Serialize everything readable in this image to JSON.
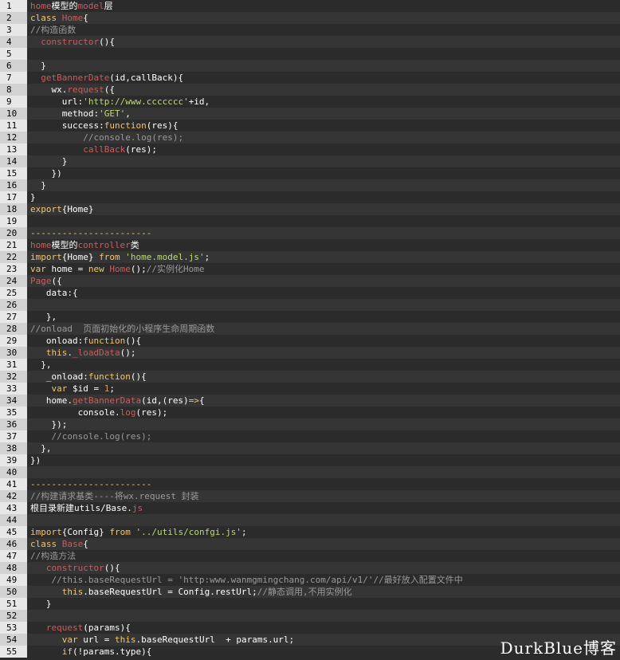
{
  "watermark": "DurkBlue博客",
  "colors": {
    "background": "#2b2b2b",
    "gutter": "#e7e7e7",
    "keyword": "#f0c674",
    "function": "#c65e5e",
    "string": "#bfd97a",
    "comment": "#9a9a9a",
    "number": "#d19a66"
  },
  "lines": [
    {
      "n": "1",
      "t": [
        [
          "fn",
          "home"
        ],
        [
          "pl",
          "模型的"
        ],
        [
          "fn",
          "model"
        ],
        [
          "pl",
          "层"
        ]
      ]
    },
    {
      "n": "2",
      "t": [
        [
          "kw",
          "class "
        ],
        [
          "fn",
          "Home"
        ],
        [
          "pl",
          "{"
        ]
      ]
    },
    {
      "n": "3",
      "t": [
        [
          "cm",
          "//构造函数"
        ]
      ]
    },
    {
      "n": "4",
      "t": [
        [
          "pl",
          "  "
        ],
        [
          "fn",
          "constructor"
        ],
        [
          "pl",
          "(){"
        ]
      ]
    },
    {
      "n": "5",
      "t": []
    },
    {
      "n": "6",
      "t": [
        [
          "pl",
          "  }"
        ]
      ]
    },
    {
      "n": "7",
      "t": [
        [
          "pl",
          "  "
        ],
        [
          "fn",
          "getBannerDate"
        ],
        [
          "pl",
          "(id,callBack){"
        ]
      ]
    },
    {
      "n": "8",
      "t": [
        [
          "pl",
          "    wx."
        ],
        [
          "fn",
          "request"
        ],
        [
          "pl",
          "({"
        ]
      ]
    },
    {
      "n": "9",
      "t": [
        [
          "pl",
          "      url:"
        ],
        [
          "str",
          "'http://www.ccccccc'"
        ],
        [
          "pl",
          "+id,"
        ]
      ]
    },
    {
      "n": "10",
      "t": [
        [
          "pl",
          "      method:"
        ],
        [
          "str",
          "'GET'"
        ],
        [
          "pl",
          ","
        ]
      ]
    },
    {
      "n": "11",
      "t": [
        [
          "pl",
          "      success:"
        ],
        [
          "kw",
          "function"
        ],
        [
          "pl",
          "(res){"
        ]
      ]
    },
    {
      "n": "12",
      "t": [
        [
          "pl",
          "          "
        ],
        [
          "cm",
          "//console.log(res);"
        ]
      ]
    },
    {
      "n": "13",
      "t": [
        [
          "pl",
          "          "
        ],
        [
          "fn",
          "callBack"
        ],
        [
          "pl",
          "(res);"
        ]
      ]
    },
    {
      "n": "14",
      "t": [
        [
          "pl",
          "      }"
        ]
      ]
    },
    {
      "n": "15",
      "t": [
        [
          "pl",
          "    })"
        ]
      ]
    },
    {
      "n": "16",
      "t": [
        [
          "pl",
          "  }"
        ]
      ]
    },
    {
      "n": "17",
      "t": [
        [
          "pl",
          "}"
        ]
      ]
    },
    {
      "n": "18",
      "t": [
        [
          "kw",
          "export"
        ],
        [
          "pl",
          "{Home}"
        ]
      ]
    },
    {
      "n": "19",
      "t": []
    },
    {
      "n": "20",
      "t": [
        [
          "kw",
          "-----------------------"
        ]
      ]
    },
    {
      "n": "21",
      "t": [
        [
          "fn",
          "home"
        ],
        [
          "pl",
          "模型的"
        ],
        [
          "fn",
          "controller"
        ],
        [
          "pl",
          "类"
        ]
      ]
    },
    {
      "n": "22",
      "t": [
        [
          "kw",
          "import"
        ],
        [
          "pl",
          "{Home} "
        ],
        [
          "kw",
          "from "
        ],
        [
          "str",
          "'home.model.js'"
        ],
        [
          "pl",
          ";"
        ]
      ]
    },
    {
      "n": "23",
      "t": [
        [
          "kw",
          "var "
        ],
        [
          "pl",
          "home = "
        ],
        [
          "kw",
          "new "
        ],
        [
          "fn",
          "Home"
        ],
        [
          "pl",
          "();"
        ],
        [
          "cm",
          "//实例化Home"
        ]
      ]
    },
    {
      "n": "24",
      "t": [
        [
          "fn",
          "Page"
        ],
        [
          "pl",
          "({"
        ]
      ]
    },
    {
      "n": "25",
      "t": [
        [
          "pl",
          "   data:{"
        ]
      ]
    },
    {
      "n": "26",
      "t": []
    },
    {
      "n": "27",
      "t": [
        [
          "pl",
          "   },"
        ]
      ]
    },
    {
      "n": "28",
      "t": [
        [
          "cm",
          "//onload  页面初始化的小程序生命周期函数"
        ]
      ]
    },
    {
      "n": "29",
      "t": [
        [
          "pl",
          "   onload:"
        ],
        [
          "kw",
          "function"
        ],
        [
          "pl",
          "(){"
        ]
      ]
    },
    {
      "n": "30",
      "t": [
        [
          "pl",
          "   "
        ],
        [
          "kw",
          "this"
        ],
        [
          "pl",
          "."
        ],
        [
          "fn",
          "_loadData"
        ],
        [
          "pl",
          "();"
        ]
      ]
    },
    {
      "n": "31",
      "t": [
        [
          "pl",
          "  },"
        ]
      ]
    },
    {
      "n": "32",
      "t": [
        [
          "pl",
          "   _onload:"
        ],
        [
          "kw",
          "function"
        ],
        [
          "pl",
          "(){"
        ]
      ]
    },
    {
      "n": "33",
      "t": [
        [
          "pl",
          "    "
        ],
        [
          "kw",
          "var "
        ],
        [
          "pl",
          "$id = "
        ],
        [
          "num",
          "1"
        ],
        [
          "pl",
          ";"
        ]
      ]
    },
    {
      "n": "34",
      "t": [
        [
          "pl",
          "   home."
        ],
        [
          "fn",
          "getBannerData"
        ],
        [
          "pl",
          "(id,(res)"
        ],
        [
          "kw",
          "=>"
        ],
        [
          "pl",
          "{"
        ]
      ]
    },
    {
      "n": "35",
      "t": [
        [
          "pl",
          "         console."
        ],
        [
          "fn",
          "log"
        ],
        [
          "pl",
          "(res);"
        ]
      ]
    },
    {
      "n": "36",
      "t": [
        [
          "pl",
          "    });"
        ]
      ]
    },
    {
      "n": "37",
      "t": [
        [
          "pl",
          "    "
        ],
        [
          "cm",
          "//console.log(res);"
        ]
      ]
    },
    {
      "n": "38",
      "t": [
        [
          "pl",
          "  },"
        ]
      ]
    },
    {
      "n": "39",
      "t": [
        [
          "pl",
          "})"
        ]
      ]
    },
    {
      "n": "40",
      "t": []
    },
    {
      "n": "41",
      "t": [
        [
          "kw",
          "-----------------------"
        ]
      ]
    },
    {
      "n": "42",
      "t": [
        [
          "cm",
          "//构建请求基类----将wx.request 封装"
        ]
      ]
    },
    {
      "n": "43",
      "t": [
        [
          "pl",
          "根目录新建utils/"
        ],
        [
          "pl",
          "Base."
        ],
        [
          "fn",
          "js"
        ]
      ]
    },
    {
      "n": "44",
      "t": []
    },
    {
      "n": "45",
      "t": [
        [
          "kw",
          "import"
        ],
        [
          "pl",
          "{Config} "
        ],
        [
          "kw",
          "from "
        ],
        [
          "str",
          "'../utils/confgi.js'"
        ],
        [
          "pl",
          ";"
        ]
      ]
    },
    {
      "n": "46",
      "t": [
        [
          "kw",
          "class "
        ],
        [
          "fn",
          "Base"
        ],
        [
          "pl",
          "{"
        ]
      ]
    },
    {
      "n": "47",
      "t": [
        [
          "cm",
          "//构造方法"
        ]
      ]
    },
    {
      "n": "48",
      "t": [
        [
          "pl",
          "   "
        ],
        [
          "fn",
          "constructor"
        ],
        [
          "pl",
          "(){"
        ]
      ]
    },
    {
      "n": "49",
      "t": [
        [
          "pl",
          "    "
        ],
        [
          "cm",
          "//this.baseRequestUrl = 'http:www.wanmgmingchang.com/api/v1/'//最好放入配置文件中"
        ]
      ]
    },
    {
      "n": "50",
      "t": [
        [
          "pl",
          "      "
        ],
        [
          "kw",
          "this"
        ],
        [
          "pl",
          ".baseRequestUrl = Config.restUrl;"
        ],
        [
          "cm",
          "//静态调用,不用实例化"
        ]
      ]
    },
    {
      "n": "51",
      "t": [
        [
          "pl",
          "   }"
        ]
      ]
    },
    {
      "n": "52",
      "t": []
    },
    {
      "n": "53",
      "t": [
        [
          "pl",
          "   "
        ],
        [
          "fn",
          "request"
        ],
        [
          "pl",
          "(params){"
        ]
      ]
    },
    {
      "n": "54",
      "t": [
        [
          "pl",
          "      "
        ],
        [
          "kw",
          "var "
        ],
        [
          "pl",
          "url = "
        ],
        [
          "kw",
          "this"
        ],
        [
          "pl",
          ".baseRequestUrl  + params.url;"
        ]
      ]
    },
    {
      "n": "55",
      "t": [
        [
          "pl",
          "      "
        ],
        [
          "kw",
          "if"
        ],
        [
          "pl",
          "(!params.type){"
        ]
      ]
    }
  ]
}
